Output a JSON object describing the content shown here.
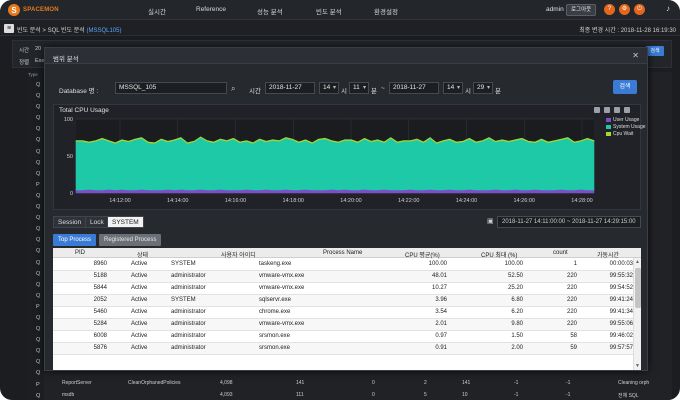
{
  "brand": {
    "mark": "S",
    "name": "SPACEMON"
  },
  "nav": {
    "items": [
      "실시간",
      "Reference",
      "성능 분석",
      "빈도 분석",
      "환경설정"
    ]
  },
  "user": {
    "name": "admin",
    "logout_label": "로그아웃"
  },
  "header_icons": {
    "icons": [
      "help-icon",
      "settings-icon",
      "power-icon",
      "bell-icon"
    ],
    "glyphs": [
      "?",
      "⚙",
      "⏻",
      "🔔"
    ]
  },
  "breadcrumb": {
    "prefix": "빈도 분석 > SQL 빈도 분석",
    "current": "(MSSQL105)"
  },
  "refresh_time": "최종 변경 시간 : 2018-11-28 16:19:30",
  "background_page": {
    "filter_labels": [
      "시간",
      "정렬"
    ],
    "filter_values": [
      "20",
      "Exe"
    ],
    "search_label": "검색",
    "type_header": "Type",
    "type_letters": [
      "Q",
      "Q",
      "Q",
      "Q",
      "Q",
      "Q",
      "Q",
      "Q",
      "Q",
      "P",
      "Q",
      "Q",
      "Q",
      "Q",
      "Q",
      "Q",
      "Q",
      "Q",
      "Q",
      "Q",
      "P",
      "Q",
      "Q",
      "Q",
      "Q",
      "Q",
      "Q",
      "P",
      "Q"
    ],
    "rows": [
      [
        "ReportServer",
        "CleanOrphanedPolicies",
        "4,098",
        "141",
        "0",
        "2",
        "141",
        "-1",
        "-1",
        "Cleaning orph"
      ],
      [
        "msdb",
        "",
        "4,093",
        "111",
        "0",
        "5",
        "10",
        "-1",
        "-1",
        "전체 SQL"
      ]
    ]
  },
  "modal": {
    "title": "범위 분석",
    "db_label": "Database 명 :",
    "db_value": "MSSQL_105",
    "time_label": "시간",
    "start_date": "2018-11-27",
    "start_hour": "14",
    "hour_unit": "시",
    "start_min": "11",
    "min_unit": "분",
    "range_sep": "~",
    "end_date": "2018-11-27",
    "end_hour": "14",
    "end_min": "29",
    "search_label": "검색"
  },
  "chart_data": {
    "type": "area",
    "title": "Total CPU Usage",
    "x_ticks": [
      "14:12:00",
      "14:14:00",
      "14:16:00",
      "14:18:00",
      "14:20:00",
      "14:22:00",
      "14:24:00",
      "14:26:00",
      "14:28:00"
    ],
    "ylim": [
      0,
      100
    ],
    "y_ticks": [
      0,
      50,
      100
    ],
    "grid": true,
    "legend_position": "top-right",
    "series": [
      {
        "name": "User Usage",
        "color": "#7b4fc9",
        "values": [
          4,
          4,
          5,
          4,
          4,
          5,
          4,
          5,
          4,
          4,
          5,
          4,
          4,
          4,
          5,
          4,
          5,
          4,
          4,
          5,
          4,
          4,
          5,
          4,
          4,
          4,
          5,
          4,
          4,
          5,
          4,
          4,
          5,
          4,
          4,
          5,
          4,
          4,
          4,
          5,
          4,
          5,
          4,
          4,
          5,
          4,
          4,
          5,
          4,
          4,
          4,
          5,
          4,
          4,
          5,
          4,
          4,
          5,
          4,
          4,
          5,
          4,
          4,
          4,
          5,
          4,
          4,
          5,
          4,
          4,
          5,
          4,
          4,
          4,
          5,
          4,
          4,
          5,
          4,
          4
        ]
      },
      {
        "name": "System Usage",
        "color": "#1ec9a8",
        "values": [
          66,
          66,
          63,
          66,
          69,
          65,
          63,
          66,
          65,
          68,
          69,
          64,
          63,
          68,
          64,
          67,
          69,
          63,
          65,
          70,
          66,
          64,
          67,
          66,
          69,
          64,
          65,
          63,
          68,
          64,
          67,
          66,
          69,
          68,
          64,
          66,
          63,
          68,
          69,
          65,
          64,
          66,
          67,
          64,
          68,
          65,
          67,
          63,
          70,
          64,
          66,
          65,
          68,
          64,
          69,
          63,
          66,
          67,
          64,
          65,
          68,
          64,
          66,
          70,
          64,
          67,
          65,
          66,
          69,
          65,
          63,
          68,
          64,
          66,
          67,
          70,
          64,
          65,
          69,
          66
        ]
      },
      {
        "name": "Cpu Wait",
        "color": "#a6d832",
        "values": [
          1,
          1,
          1,
          1,
          1,
          1,
          1,
          1,
          1,
          1,
          1,
          1,
          1,
          1,
          1,
          1,
          1,
          1,
          1,
          1,
          1,
          1,
          1,
          1,
          1,
          1,
          1,
          1,
          1,
          1,
          1,
          1,
          1,
          1,
          1,
          1,
          1,
          1,
          1,
          1,
          1,
          1,
          1,
          1,
          1,
          1,
          1,
          1,
          1,
          1,
          1,
          1,
          1,
          1,
          1,
          1,
          1,
          1,
          1,
          1,
          1,
          1,
          1,
          1,
          1,
          1,
          1,
          1,
          1,
          1,
          1,
          1,
          1,
          1,
          1,
          1,
          1,
          1,
          1,
          1
        ]
      }
    ]
  },
  "tabs": {
    "items": [
      "Session",
      "Lock",
      "SYSTEM"
    ],
    "active_index": 2
  },
  "range_display": "2018-11-27 14:11:00:00 ~ 2018-11-27 14:29:15:00",
  "process_tabs": {
    "items": [
      "Top Process",
      "Registered Process"
    ],
    "active_index": 0
  },
  "table": {
    "columns": [
      "PID",
      "상태",
      "사용자 아이디",
      "Process Name",
      "CPU 평균(%)",
      "CPU 최대 (%)",
      "count",
      "가동시간"
    ],
    "rows": [
      [
        "8960",
        "Active",
        "SYSTEM",
        "taskeng.exe",
        "100.00",
        "100.00",
        "1",
        "00:00:03"
      ],
      [
        "5188",
        "Active",
        "administrator",
        "vmware-vmx.exe",
        "48.01",
        "52.50",
        "220",
        "99:55:32"
      ],
      [
        "5844",
        "Active",
        "administrator",
        "vmware-vmx.exe",
        "10.27",
        "25.20",
        "220",
        "99:54:52"
      ],
      [
        "2052",
        "Active",
        "SYSTEM",
        "sqlservr.exe",
        "3.96",
        "6.80",
        "220",
        "99:41:24"
      ],
      [
        "5460",
        "Active",
        "administrator",
        "chrome.exe",
        "3.54",
        "6.20",
        "220",
        "99:41:34"
      ],
      [
        "5284",
        "Active",
        "administrator",
        "vmware-vmx.exe",
        "2.01",
        "9.80",
        "220",
        "99:55:06"
      ],
      [
        "6008",
        "Active",
        "administrator",
        "srsmon.exe",
        "0.97",
        "1.50",
        "58",
        "99:46:02"
      ],
      [
        "5876",
        "Active",
        "administrator",
        "srsmon.exe",
        "0.91",
        "2.00",
        "59",
        "99:57:57"
      ]
    ]
  }
}
